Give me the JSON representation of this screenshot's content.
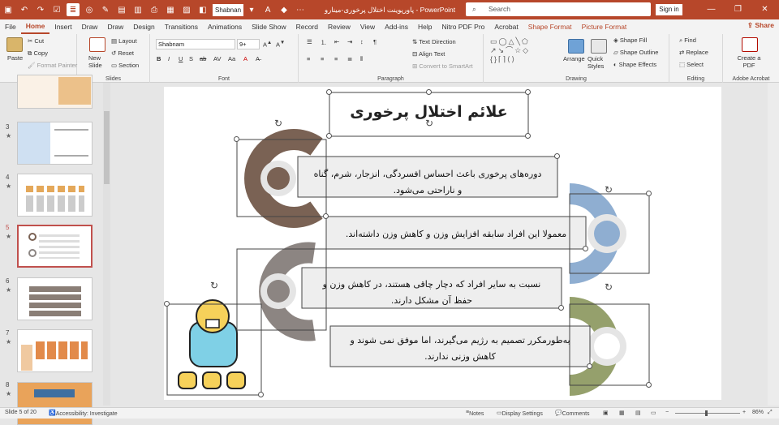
{
  "qat": {
    "font_value": "Shabnan"
  },
  "window": {
    "title": "پاورپوینت اختلال پرخوری-مینارو  -  PowerPoint",
    "search_placeholder": "Search",
    "signin": "Sign in"
  },
  "tabs": [
    "File",
    "Home",
    "Insert",
    "Draw",
    "Draw",
    "Design",
    "Transitions",
    "Animations",
    "Slide Show",
    "Record",
    "Review",
    "View",
    "Add-ins",
    "Help",
    "Nitro PDF Pro",
    "Acrobat",
    "Shape Format",
    "Picture Format"
  ],
  "share_label": "Share",
  "ribbon": {
    "clipboard": {
      "paste": "Paste",
      "cut": "Cut",
      "copy": "Copy",
      "format_painter": "Format Painter",
      "label": "Clipboard"
    },
    "slides": {
      "new_slide": "New Slide",
      "layout": "Layout",
      "reset": "Reset",
      "section": "Section",
      "label": "Slides"
    },
    "font": {
      "family": "Shabnam",
      "size": "9+",
      "label": "Font"
    },
    "paragraph": {
      "text_direction": "Text Direction",
      "align_text": "Align Text",
      "smartart": "Convert to SmartArt",
      "label": "Paragraph"
    },
    "drawing": {
      "arrange": "Arrange",
      "quick_styles": "Quick Styles",
      "shape_fill": "Shape Fill",
      "shape_outline": "Shape Outline",
      "shape_effects": "Shape Effects",
      "label": "Drawing"
    },
    "editing": {
      "find": "Find",
      "replace": "Replace",
      "select": "Select",
      "label": "Editing"
    },
    "acrobat": {
      "create_pdf": "Create a PDF",
      "label": "Adobe Acrobat"
    }
  },
  "thumbnails": [
    {
      "num": "3",
      "star": "★"
    },
    {
      "num": "4",
      "star": "★"
    },
    {
      "num": "5",
      "star": "★"
    },
    {
      "num": "6",
      "star": "★"
    },
    {
      "num": "7",
      "star": "★"
    },
    {
      "num": "8",
      "star": "★"
    }
  ],
  "slide": {
    "title": "علائم اختلال پرخوری",
    "items": [
      {
        "line1": "دوره‌های پرخوری باعث احساس افسردگی، انزجار، شرم، گناه",
        "line2": "و ناراحتی می‌شود."
      },
      {
        "line1": "معمولا این افراد سابقه افزایش وزن و کاهش وزن داشته‌اند.",
        "line2": ""
      },
      {
        "line1": "نسبت به سایر افراد که دچار چاقی هستند، در کاهش وزن و",
        "line2": "حفظ آن مشکل دارند."
      },
      {
        "line1": "به‌طورمکرر تصمیم به رژیم می‌گیرند، اما موفق نمی شوند و",
        "line2": "کاهش وزنی ندارند."
      }
    ]
  },
  "colors": {
    "brand": "#b7472a",
    "ring1": "#7a6254",
    "ring2": "#8faed1",
    "ring3": "#8c8582",
    "ring4": "#95a06c"
  },
  "status": {
    "slide": "Slide 5 of 20",
    "accessibility": "Accessibility: Investigate",
    "notes": "Notes",
    "display": "Display Settings",
    "comments": "Comments",
    "zoom": "86%"
  }
}
